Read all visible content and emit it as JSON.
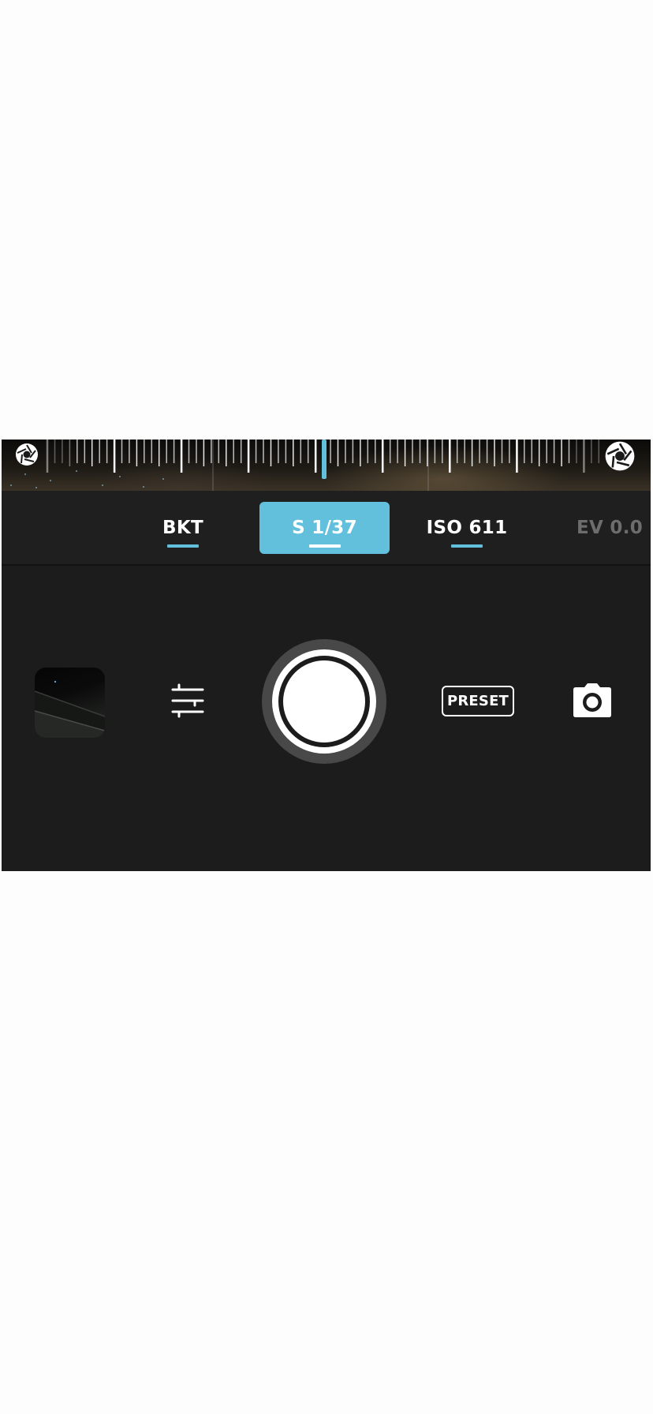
{
  "dial": {
    "left_icon": "aperture-icon",
    "right_icon": "aperture-icon",
    "indicator_color": "#62c0dd"
  },
  "modes": {
    "active_color": "#62c0dd",
    "tabs": [
      {
        "label": "BKT",
        "state": "inactive"
      },
      {
        "label": "S 1/37",
        "state": "active"
      },
      {
        "label": "ISO 611",
        "state": "inactive"
      },
      {
        "label": "EV 0.0",
        "state": "disabled"
      }
    ]
  },
  "controls": {
    "thumbnail_icon": "last-photo-thumbnail",
    "adjust_icon": "sliders-icon",
    "shutter_icon": "shutter-button",
    "preset_label": "PRESET",
    "camera_icon": "camera-icon"
  },
  "colors": {
    "panel_background": "#1c1c1c",
    "accent": "#62c0dd",
    "disabled_text": "#6d6d6d"
  }
}
